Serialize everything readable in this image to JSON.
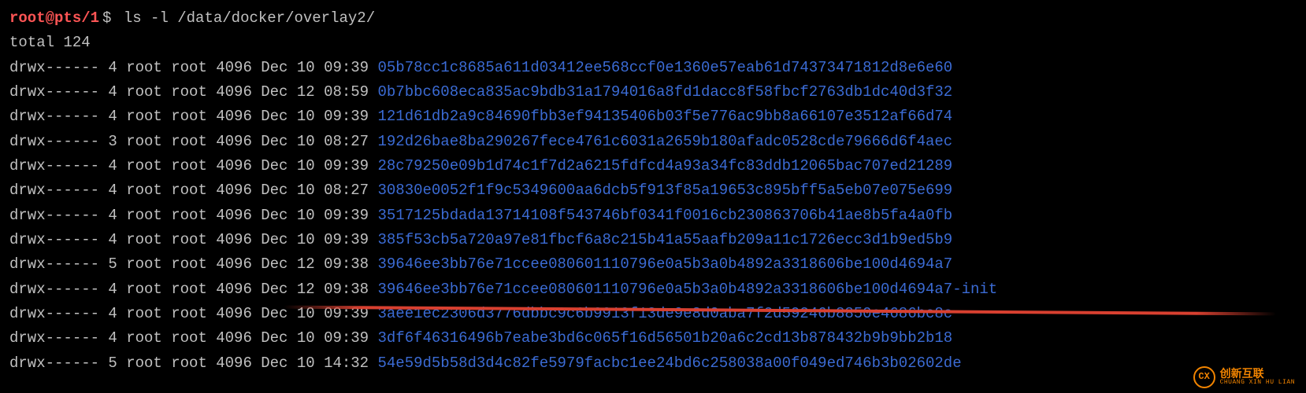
{
  "prompt": {
    "user_host": "root@pts/1",
    "sign": "$",
    "command": "ls -l /data/docker/overlay2/"
  },
  "total": "total 124",
  "rows": [
    {
      "perm": "drwx------ 4 root root 4096 Dec 10 09:39",
      "name": "05b78cc1c8685a611d03412ee568ccf0e1360e57eab61d74373471812d8e6e60"
    },
    {
      "perm": "drwx------ 4 root root 4096 Dec 12 08:59",
      "name": "0b7bbc608eca835ac9bdb31a1794016a8fd1dacc8f58fbcf2763db1dc40d3f32"
    },
    {
      "perm": "drwx------ 4 root root 4096 Dec 10 09:39",
      "name": "121d61db2a9c84690fbb3ef94135406b03f5e776ac9bb8a66107e3512af66d74"
    },
    {
      "perm": "drwx------ 3 root root 4096 Dec 10 08:27",
      "name": "192d26bae8ba290267fece4761c6031a2659b180afadc0528cde79666d6f4aec"
    },
    {
      "perm": "drwx------ 4 root root 4096 Dec 10 09:39",
      "name": "28c79250e09b1d74c1f7d2a6215fdfcd4a93a34fc83ddb12065bac707ed21289"
    },
    {
      "perm": "drwx------ 4 root root 4096 Dec 10 08:27",
      "name": "30830e0052f1f9c5349600aa6dcb5f913f85a19653c895bff5a5eb07e075e699"
    },
    {
      "perm": "drwx------ 4 root root 4096 Dec 10 09:39",
      "name": "3517125bdada13714108f543746bf0341f0016cb230863706b41ae8b5fa4a0fb"
    },
    {
      "perm": "drwx------ 4 root root 4096 Dec 10 09:39",
      "name": "385f53cb5a720a97e81fbcf6a8c215b41a55aafb209a11c1726ecc3d1b9ed5b9"
    },
    {
      "perm": "drwx------ 5 root root 4096 Dec 12 09:38",
      "name": "39646ee3bb76e71ccee080601110796e0a5b3a0b4892a3318606be100d4694a7"
    },
    {
      "perm": "drwx------ 4 root root 4096 Dec 12 09:38",
      "name": "39646ee3bb76e71ccee080601110796e0a5b3a0b4892a3318606be100d4694a7-init"
    },
    {
      "perm": "drwx------ 4 root root 4096 Dec 10 09:39",
      "name": "3aee1ec2306d3776dbbc9c6b9913f13de9e8d0aba7f2d59246b8850e4686bc8c"
    },
    {
      "perm": "drwx------ 4 root root 4096 Dec 10 09:39",
      "name": "3df6f46316496b7eabe3bd6c065f16d56501b20a6c2cd13b878432b9b9bb2b18"
    },
    {
      "perm": "drwx------ 5 root root 4096 Dec 10 14:32",
      "name": "54e59d5b58d3d4c82fe5979facbc1ee24bd6c258038a00f049ed746b3b02602de"
    }
  ],
  "watermark": {
    "cn": "创新互联",
    "en": "CHUANG XIN HU LIAN"
  }
}
